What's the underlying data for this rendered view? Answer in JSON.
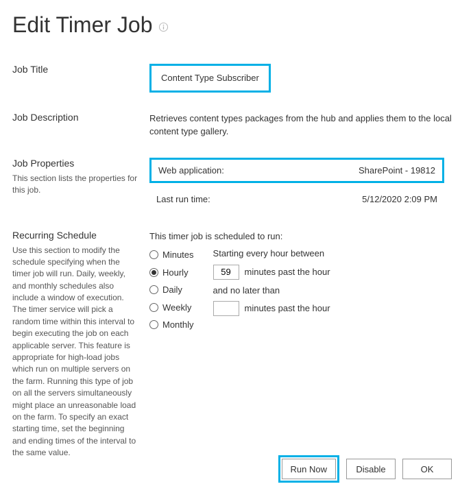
{
  "page": {
    "title": "Edit Timer Job"
  },
  "section_titles": {
    "job_title": "Job Title",
    "job_description": "Job Description",
    "job_properties": "Job Properties",
    "recurring_schedule": "Recurring Schedule"
  },
  "section_help": {
    "job_properties": "This section lists the properties for this job.",
    "recurring_schedule": "Use this section to modify the schedule specifying when the timer job will run. Daily, weekly, and monthly schedules also include a window of execution. The timer service will pick a random time within this interval to begin executing the job on each applicable server. This feature is appropriate for high-load jobs which run on multiple servers on the farm. Running this type of job on all the servers simultaneously might place an unreasonable load on the farm. To specify an exact starting time, set the beginning and ending times of the interval to the same value."
  },
  "job": {
    "title_value": "Content Type Subscriber",
    "description_value": "Retrieves content types packages from the hub and applies them to the local content type gallery."
  },
  "properties": {
    "webapp_label": "Web application:",
    "webapp_value": "SharePoint - 19812",
    "lastrun_label": "Last run time:",
    "lastrun_value": "5/12/2020 2:09 PM"
  },
  "schedule": {
    "intro": "This timer job is scheduled to run:",
    "options": {
      "minutes": "Minutes",
      "hourly": "Hourly",
      "daily": "Daily",
      "weekly": "Weekly",
      "monthly": "Monthly"
    },
    "selected": "hourly",
    "line1": "Starting every hour between",
    "start_value": "59",
    "line2_suffix": "minutes past the hour",
    "line3": "and no later than",
    "end_value": "",
    "line4_suffix": "minutes past the hour"
  },
  "buttons": {
    "run_now": "Run Now",
    "disable": "Disable",
    "ok": "OK"
  }
}
